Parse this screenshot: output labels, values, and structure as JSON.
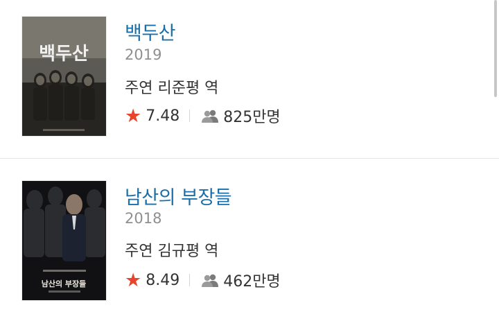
{
  "movies": [
    {
      "title": "백두산",
      "year": "2019",
      "role": "주연 리준평 역",
      "rating": "7.48",
      "audience": "825만명",
      "poster_text": "백두산",
      "icons": [
        "star-icon",
        "people-icon"
      ]
    },
    {
      "title": "남산의 부장들",
      "year": "2018",
      "role": "주연 김규평 역",
      "rating": "8.49",
      "audience": "462만명",
      "poster_text": "남산의 부장들",
      "icons": [
        "star-icon",
        "people-icon"
      ]
    }
  ],
  "colors": {
    "title": "#1b6ea8",
    "star": "#e8432b",
    "year": "#8f8f8f",
    "text": "#333333"
  }
}
